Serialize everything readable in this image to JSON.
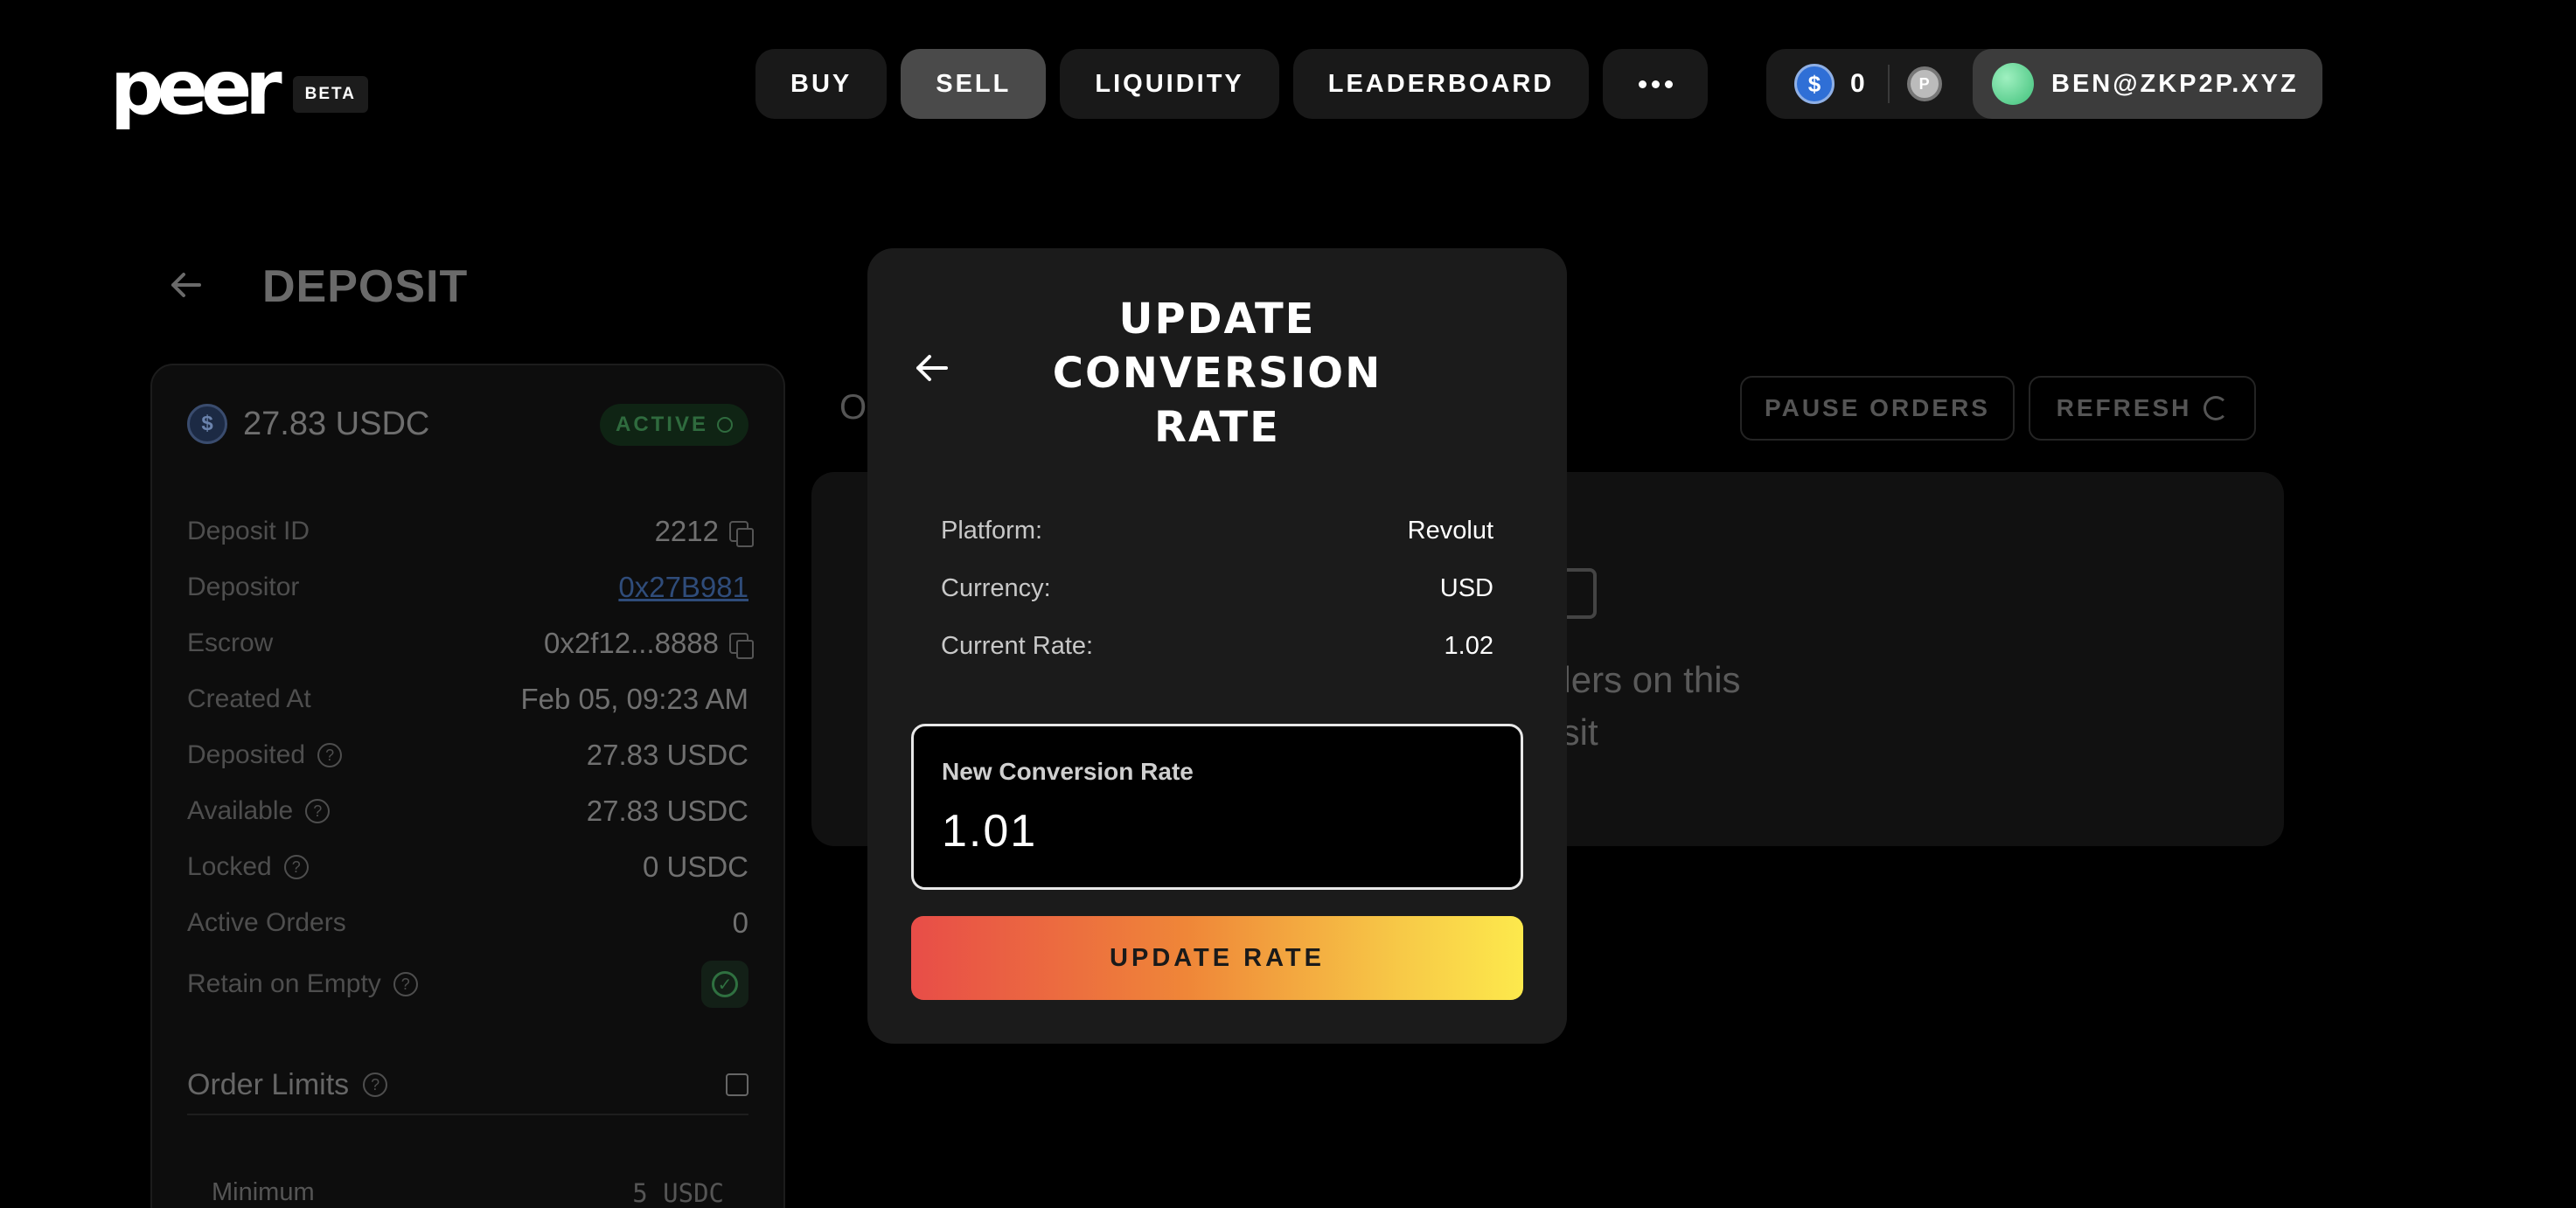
{
  "header": {
    "logo_text": "peer",
    "beta_label": "BETA",
    "nav": [
      {
        "label": "BUY"
      },
      {
        "label": "SELL"
      },
      {
        "label": "LIQUIDITY"
      },
      {
        "label": "LEADERBOARD"
      }
    ],
    "more_icon": "more-horizontal-icon",
    "account": {
      "usdc_balance": "0",
      "username": "BEN@ZKP2P.XYZ"
    }
  },
  "page": {
    "title": "DEPOSIT",
    "deposit": {
      "amount": "27.83 USDC",
      "status": "ACTIVE",
      "rows": [
        {
          "label": "Deposit ID",
          "value": "2212"
        },
        {
          "label": "Depositor",
          "value": "0x27B981"
        },
        {
          "label": "Escrow",
          "value": "0x2f12...8888"
        },
        {
          "label": "Created At",
          "value": "Feb 05, 09:23 AM"
        },
        {
          "label": "Deposited",
          "value": "27.83 USDC"
        },
        {
          "label": "Available",
          "value": "27.83 USDC"
        },
        {
          "label": "Locked",
          "value": "0 USDC"
        },
        {
          "label": "Active Orders",
          "value": "0"
        },
        {
          "label": "Retain on Empty",
          "value": ""
        }
      ],
      "order_limits_title": "Order Limits",
      "minimum_label": "Minimum",
      "minimum_value": "5 USDC"
    },
    "orders": {
      "title_fragment": "O",
      "pause_label": "PAUSE ORDERS",
      "refresh_label": "REFRESH",
      "empty_line1": "rders on this",
      "empty_line2": "osit"
    }
  },
  "modal": {
    "title": "UPDATE CONVERSION RATE",
    "info": [
      {
        "label": "Platform:",
        "value": "Revolut"
      },
      {
        "label": "Currency:",
        "value": "USD"
      },
      {
        "label": "Current Rate:",
        "value": "1.02"
      }
    ],
    "new_rate_label": "New Conversion Rate",
    "new_rate_value": "1.01",
    "submit_label": "UPDATE RATE"
  },
  "colors": {
    "background": "#000000",
    "modal_bg": "#1b1b1b",
    "button_gradient_start": "#e84d48",
    "button_gradient_end": "#fde94c",
    "active_green": "#2f6b3e"
  }
}
